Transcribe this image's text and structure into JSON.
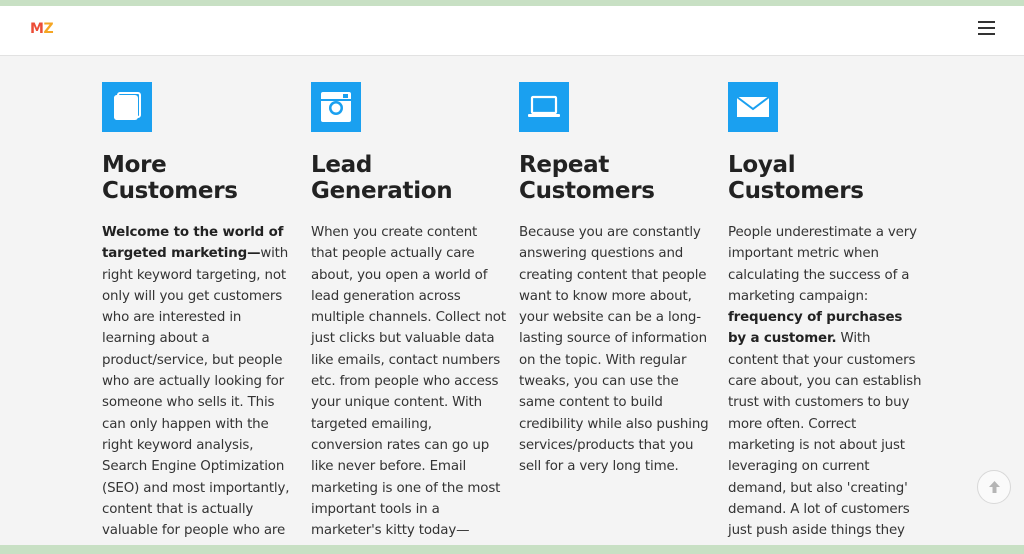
{
  "header": {
    "logo_m": "M",
    "logo_z": "Z",
    "menu_icon": "hamburger-menu-icon"
  },
  "colors": {
    "accent": "#1aa0f0",
    "logo_m": "#ec4d37",
    "logo_z": "#f5a623",
    "strip": "#c8e0c4"
  },
  "features": [
    {
      "icon": "book-icon",
      "title_line1": "More",
      "title_line2": "Customers",
      "bold_intro": "Welcome to the world of targeted marketing—",
      "text": "with right keyword targeting, not only will you get customers who are interested in learning about a product/service, but people who are actually looking for someone who sells it. This can only happen with the right keyword analysis, Search Engine Optimization (SEO) and most importantly, content that is actually valuable for people who are"
    },
    {
      "icon": "instagram-icon",
      "title_line1": "Lead",
      "title_line2": "Generation",
      "text": "When you create content that people actually care about, you open a world of lead generation across multiple channels. Collect not just clicks but valuable data like emails, contact numbers etc. from people who access your unique content. With targeted emailing, conversion rates can go up like never before. Email marketing is one of the most important tools in a marketer's kitty today—"
    },
    {
      "icon": "laptop-icon",
      "title_line1": "Repeat",
      "title_line2": "Customers",
      "text": "Because you are constantly answering questions and creating content that people want to know more about, your website can be a long-lasting source of information on the topic. With regular tweaks, you can use the same content to build credibility while also pushing services/products that you sell for a very long time."
    },
    {
      "icon": "envelope-icon",
      "title_line1": "Loyal",
      "title_line2": "Customers",
      "text_before": "People underestimate a very important metric when calculating the success of a marketing campaign: ",
      "bold_mid": "frequency of purchases by a customer.",
      "text_after": " With content that your customers care about, you can establish trust with customers to buy more often. Correct marketing is not about just leveraging on current demand, but also 'creating' demand. A lot of customers just push aside things they"
    }
  ],
  "scroll_top": {
    "icon": "arrow-up-icon"
  }
}
